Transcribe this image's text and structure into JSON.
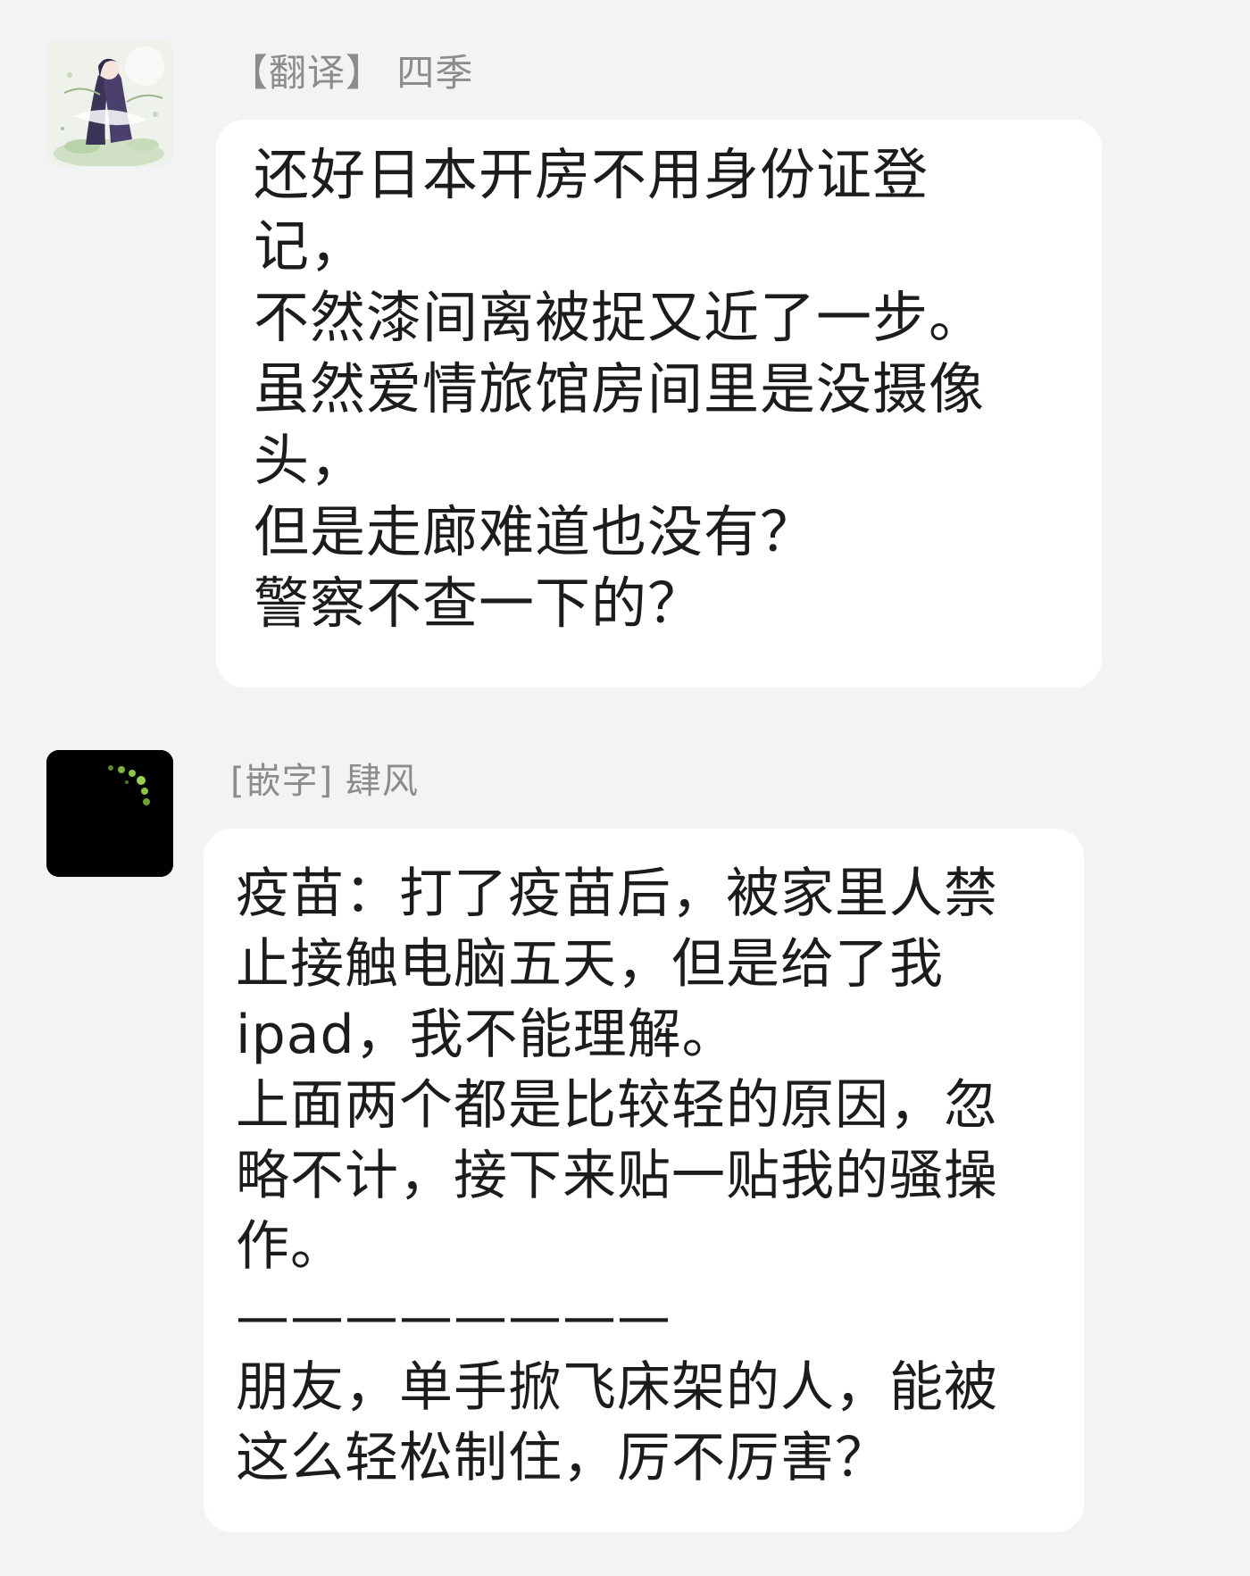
{
  "chat": {
    "messages": [
      {
        "sender": "【翻译】 四季",
        "avatar_icon": "anime-girl-avatar-icon",
        "lines": [
          "还好日本开房不用身份证登",
          "记，",
          "不然漆间离被捉又近了一步。",
          "虽然爱情旅馆房间里是没摄像",
          "头，",
          "但是走廊难道也没有？",
          "警察不查一下的？"
        ]
      },
      {
        "sender": "[嵌字] 肆风",
        "avatar_icon": "dark-fireflies-avatar-icon",
        "lines": [
          "疫苗：打了疫苗后，被家里人禁",
          "止接触电脑五天，但是给了我",
          "ipad，我不能理解。",
          "上面两个都是比较轻的原因，忽",
          "略不计，接下来贴一贴我的骚操",
          "作。",
          "————————",
          "朋友，单手掀飞床架的人，能被",
          "这么轻松制住，厉不厉害？"
        ]
      }
    ]
  },
  "colors": {
    "background": "#f2f3f5",
    "bubble": "#ffffff",
    "sender_text": "#8c8c8c",
    "message_text": "#1c1c1c"
  }
}
